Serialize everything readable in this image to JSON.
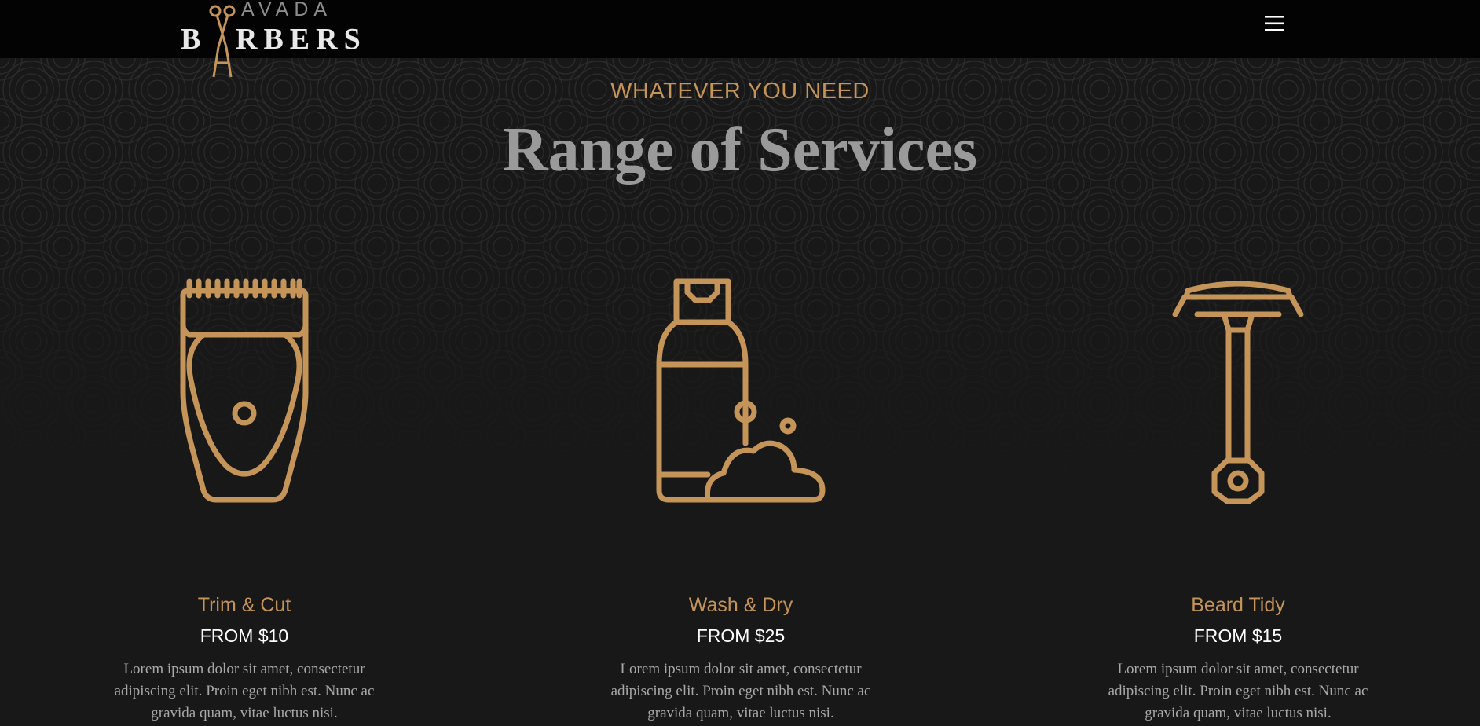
{
  "header": {
    "logo_top": "AVADA",
    "logo_b": "B",
    "logo_rest": "RBERS",
    "menu_icon": "hamburger-menu-icon"
  },
  "section": {
    "eyebrow": "WHATEVER YOU NEED",
    "title": "Range of Services"
  },
  "services": [
    {
      "icon": "hair-clipper-icon",
      "name": "Trim & Cut",
      "price": "FROM $10",
      "description": "Lorem ipsum dolor sit amet, consectetur adipiscing elit. Proin eget nibh est. Nunc ac gravida quam, vitae luctus nisi."
    },
    {
      "icon": "shampoo-bottle-icon",
      "name": "Wash & Dry",
      "price": "FROM $25",
      "description": "Lorem ipsum dolor sit amet, consectetur adipiscing elit. Proin eget nibh est. Nunc ac gravida quam, vitae luctus nisi."
    },
    {
      "icon": "safety-razor-icon",
      "name": "Beard Tidy",
      "price": "FROM $15",
      "description": "Lorem ipsum dolor sit amet, consectetur adipiscing elit. Proin eget nibh est. Nunc ac gravida quam, vitae luctus nisi."
    }
  ],
  "colors": {
    "accent": "#c49458",
    "background": "#181818",
    "header": "#030303"
  }
}
